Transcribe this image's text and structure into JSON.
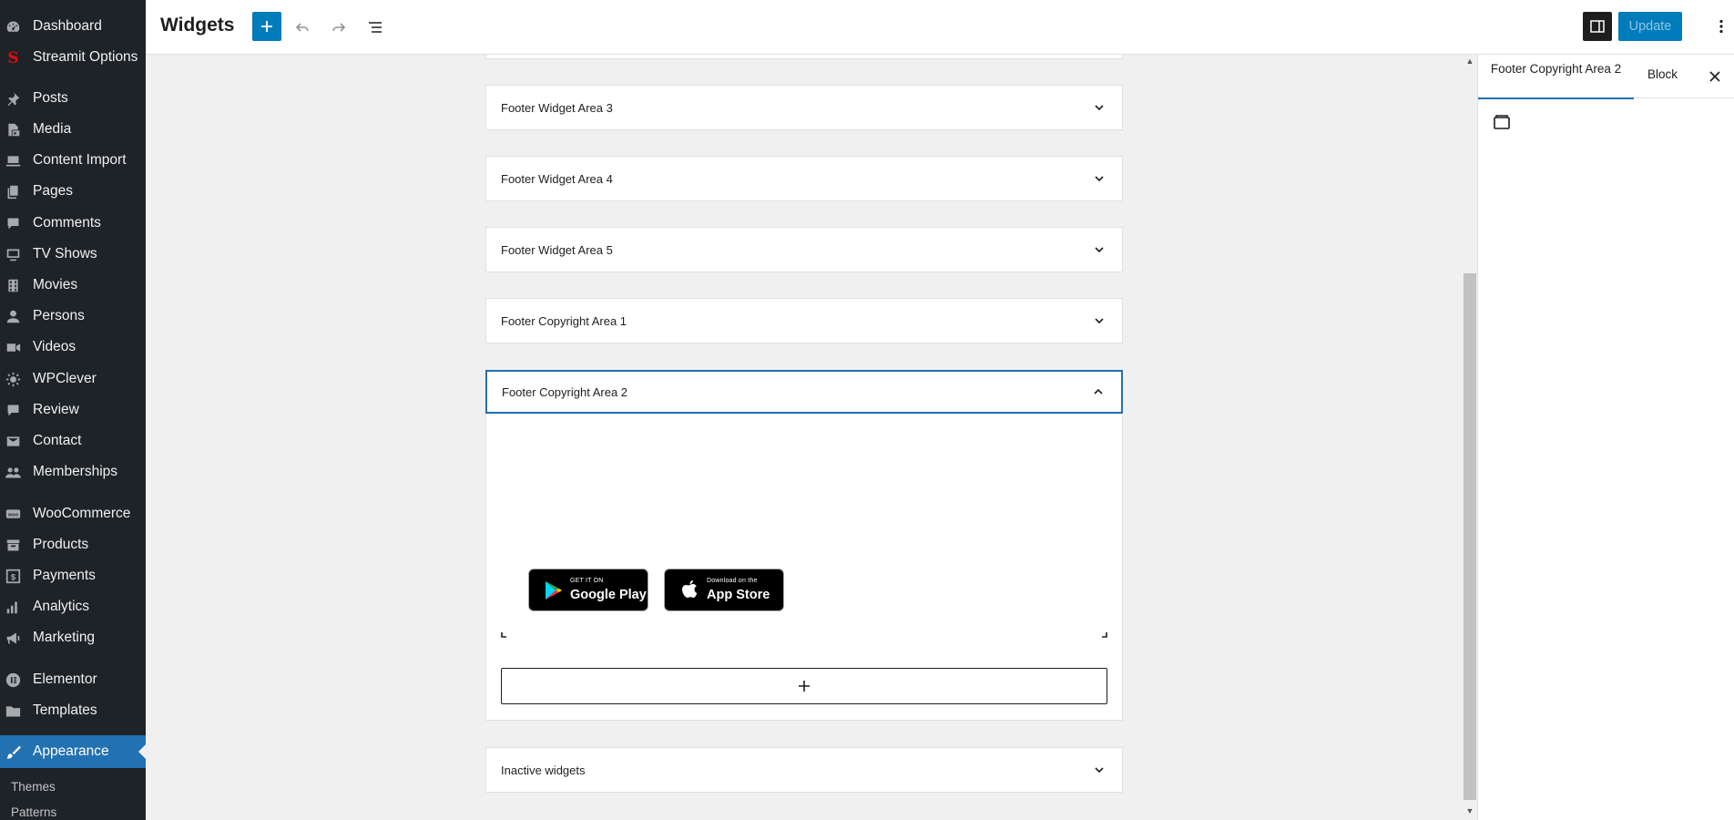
{
  "sidebar": {
    "items": [
      {
        "label": "Dashboard",
        "icon": "dashboard-icon"
      },
      {
        "label": "Streamit Options",
        "icon": "streamit-logo-icon"
      },
      {
        "label": "Posts",
        "icon": "pin-icon"
      },
      {
        "label": "Media",
        "icon": "media-icon"
      },
      {
        "label": "Content Import",
        "icon": "import-icon"
      },
      {
        "label": "Pages",
        "icon": "pages-icon"
      },
      {
        "label": "Comments",
        "icon": "comment-icon"
      },
      {
        "label": "TV Shows",
        "icon": "tv-icon"
      },
      {
        "label": "Movies",
        "icon": "film-icon"
      },
      {
        "label": "Persons",
        "icon": "person-icon"
      },
      {
        "label": "Videos",
        "icon": "video-icon"
      },
      {
        "label": "WPClever",
        "icon": "wpclever-icon"
      },
      {
        "label": "Review",
        "icon": "review-icon"
      },
      {
        "label": "Contact",
        "icon": "mail-icon"
      },
      {
        "label": "Memberships",
        "icon": "memberships-icon"
      },
      {
        "label": "WooCommerce",
        "icon": "woo-icon"
      },
      {
        "label": "Products",
        "icon": "archive-icon"
      },
      {
        "label": "Payments",
        "icon": "dollar-icon"
      },
      {
        "label": "Analytics",
        "icon": "bar-chart-icon"
      },
      {
        "label": "Marketing",
        "icon": "megaphone-icon"
      },
      {
        "label": "Elementor",
        "icon": "elementor-icon"
      },
      {
        "label": "Templates",
        "icon": "folder-icon"
      },
      {
        "label": "Appearance",
        "icon": "brush-icon"
      }
    ],
    "submenu": [
      "Themes",
      "Patterns"
    ]
  },
  "topbar": {
    "title": "Widgets",
    "update_label": "Update"
  },
  "areas": [
    {
      "label": "Footer Widget Area 3"
    },
    {
      "label": "Footer Widget Area 4"
    },
    {
      "label": "Footer Widget Area 5"
    },
    {
      "label": "Footer Copyright Area 1"
    },
    {
      "label": "Footer Copyright Area 2"
    },
    {
      "label": "Inactive widgets"
    }
  ],
  "store_buttons": {
    "google": {
      "small": "GET IT ON",
      "big": "Google Play"
    },
    "apple": {
      "small": "Download on the",
      "big": "App Store"
    }
  },
  "inspector": {
    "tab_area": "Footer Copyright Area 2",
    "tab_block": "Block"
  },
  "colors": {
    "accent": "#007cba",
    "admin_sidebar": "#1d2327",
    "active_menu": "#2271b1"
  }
}
